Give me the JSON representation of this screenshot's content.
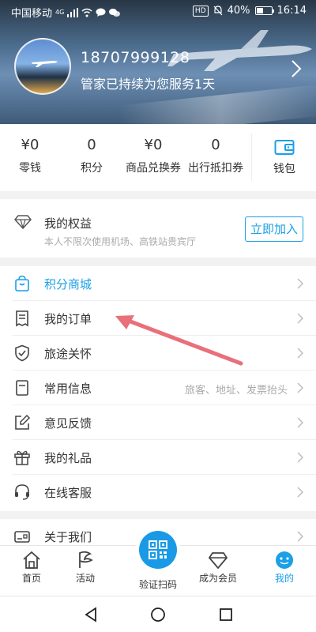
{
  "status_bar": {
    "carrier": "中国移动",
    "network": "4G",
    "hd": "HD",
    "battery": "40%",
    "time": "16:14"
  },
  "profile": {
    "phone": "18707999128",
    "service_text": "管家已持续为您服务1天"
  },
  "wallet": {
    "stats": [
      {
        "value": "¥0",
        "label": "零钱"
      },
      {
        "value": "0",
        "label": "积分"
      },
      {
        "value": "¥0",
        "label": "商品兑换券"
      },
      {
        "value": "0",
        "label": "出行抵扣券"
      }
    ],
    "wallet_label": "钱包"
  },
  "rights": {
    "title": "我的权益",
    "subtitle": "本人不限次使用机场、高铁站贵宾厅",
    "join_label": "立即加入"
  },
  "menu": {
    "items": [
      {
        "label": "积分商城",
        "icon": "bag-icon",
        "hint": ""
      },
      {
        "label": "我的订单",
        "icon": "receipt-icon",
        "hint": ""
      },
      {
        "label": "旅途关怀",
        "icon": "shield-check-icon",
        "hint": ""
      },
      {
        "label": "常用信息",
        "icon": "document-icon",
        "hint": "旅客、地址、发票抬头"
      },
      {
        "label": "意见反馈",
        "icon": "edit-icon",
        "hint": ""
      },
      {
        "label": "我的礼品",
        "icon": "gift-icon",
        "hint": ""
      },
      {
        "label": "在线客服",
        "icon": "headset-icon",
        "hint": ""
      }
    ],
    "about_label": "关于我们"
  },
  "tabs": {
    "home": "首页",
    "activity": "活动",
    "scan": "验证扫码",
    "member": "成为会员",
    "mine": "我的"
  },
  "colors": {
    "accent": "#1aa0e6",
    "annotation_arrow": "#e8707a"
  }
}
